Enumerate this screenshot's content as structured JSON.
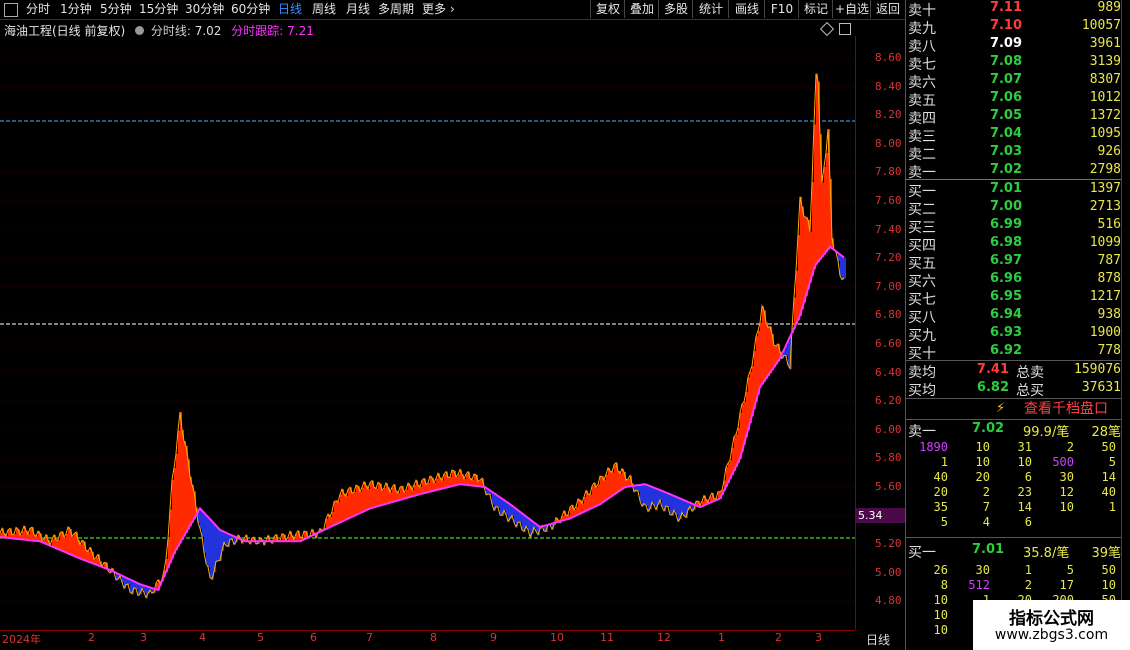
{
  "toolbar": {
    "periods": [
      "分时",
      "1分钟",
      "5分钟",
      "15分钟",
      "30分钟",
      "60分钟",
      "日线",
      "周线",
      "月线",
      "多周期",
      "更多"
    ],
    "active": "日线",
    "buttons": [
      "复权",
      "叠加",
      "多股",
      "统计",
      "画线",
      "F10",
      "标记",
      "+自选",
      "返回"
    ]
  },
  "chart": {
    "stock_name": "海油工程(日线 前复权)",
    "indicator_label": "分时线:",
    "indicator_value": "7.02",
    "trace_label": "分时跟踪:",
    "trace_value": "7.21",
    "current_price_tag": "5.34",
    "y_ticks": [
      "8.60",
      "8.40",
      "8.20",
      "8.00",
      "7.80",
      "7.60",
      "7.40",
      "7.20",
      "7.00",
      "6.80",
      "6.60",
      "6.40",
      "6.20",
      "6.00",
      "5.80",
      "5.60",
      "5.40",
      "5.20",
      "5.00",
      "4.80"
    ],
    "x_ticks": [
      "2024年",
      "2",
      "3",
      "4",
      "5",
      "6",
      "7",
      "8",
      "9",
      "10",
      "11",
      "12",
      "1",
      "2",
      "3"
    ],
    "period_label": "日线",
    "colors": {
      "ma_line": "#ff33ff",
      "up_fill": "#ff2a00",
      "down_fill": "#2233dd",
      "blue_dash": "#4ab0ff",
      "white_dash": "#ffffff",
      "green_dash": "#66ff33"
    }
  },
  "order_book": {
    "asks": [
      {
        "label": "卖十",
        "price": "7.11",
        "vol": "989"
      },
      {
        "label": "卖九",
        "price": "7.10",
        "vol": "10057"
      },
      {
        "label": "卖八",
        "price": "7.09",
        "vol": "3961"
      },
      {
        "label": "卖七",
        "price": "7.08",
        "vol": "3139"
      },
      {
        "label": "卖六",
        "price": "7.07",
        "vol": "8307"
      },
      {
        "label": "卖五",
        "price": "7.06",
        "vol": "1012"
      },
      {
        "label": "卖四",
        "price": "7.05",
        "vol": "1372"
      },
      {
        "label": "卖三",
        "price": "7.04",
        "vol": "1095"
      },
      {
        "label": "卖二",
        "price": "7.03",
        "vol": "926"
      },
      {
        "label": "卖一",
        "price": "7.02",
        "vol": "2798"
      }
    ],
    "bids": [
      {
        "label": "买一",
        "price": "7.01",
        "vol": "1397"
      },
      {
        "label": "买二",
        "price": "7.00",
        "vol": "2713"
      },
      {
        "label": "买三",
        "price": "6.99",
        "vol": "516"
      },
      {
        "label": "买四",
        "price": "6.98",
        "vol": "1099"
      },
      {
        "label": "买五",
        "price": "6.97",
        "vol": "787"
      },
      {
        "label": "买六",
        "price": "6.96",
        "vol": "878"
      },
      {
        "label": "买七",
        "price": "6.95",
        "vol": "1217"
      },
      {
        "label": "买八",
        "price": "6.94",
        "vol": "938"
      },
      {
        "label": "买九",
        "price": "6.93",
        "vol": "1900"
      },
      {
        "label": "买十",
        "price": "6.92",
        "vol": "778"
      }
    ],
    "avg_sell_label": "卖均",
    "avg_sell": "7.41",
    "total_sell_label": "总卖",
    "total_sell": "159076",
    "avg_buy_label": "买均",
    "avg_buy": "6.82",
    "total_buy_label": "总买",
    "total_buy": "37631",
    "thousand_button": "查看千档盘口",
    "sell1": {
      "label": "卖一",
      "price": "7.02",
      "count": "99.9/笔",
      "orders": "28笔",
      "grid": [
        [
          "1890",
          "10",
          "31",
          "2",
          "50"
        ],
        [
          "1",
          "10",
          "10",
          "500",
          "5"
        ],
        [
          "40",
          "20",
          "6",
          "30",
          "14"
        ],
        [
          "20",
          "2",
          "23",
          "12",
          "40"
        ],
        [
          "35",
          "7",
          "14",
          "10",
          "1"
        ],
        [
          "5",
          "4",
          "6",
          "",
          ""
        ]
      ]
    },
    "buy1": {
      "label": "买一",
      "price": "7.01",
      "count": "35.8/笔",
      "orders": "39笔",
      "grid": [
        [
          "26",
          "30",
          "1",
          "5",
          "50"
        ],
        [
          "8",
          "512",
          "2",
          "17",
          "10"
        ],
        [
          "10",
          "1",
          "20",
          "200",
          "50"
        ],
        [
          "10",
          "",
          "",
          "",
          ""
        ],
        [
          "10",
          "",
          "",
          "",
          ""
        ]
      ]
    }
  },
  "watermark": {
    "title": "指标公式网",
    "url": "www.zbgs3.com"
  }
}
